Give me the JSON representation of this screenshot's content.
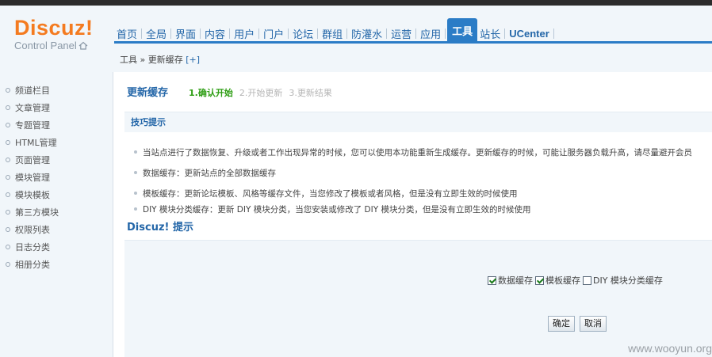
{
  "header": {
    "logo": "Discuz!",
    "logo_sub": "Control Panel",
    "nav": [
      {
        "label": "首页",
        "active": false
      },
      {
        "label": "全局",
        "active": false
      },
      {
        "label": "界面",
        "active": false
      },
      {
        "label": "内容",
        "active": false
      },
      {
        "label": "用户",
        "active": false
      },
      {
        "label": "门户",
        "active": false
      },
      {
        "label": "论坛",
        "active": false
      },
      {
        "label": "群组",
        "active": false
      },
      {
        "label": "防灌水",
        "active": false
      },
      {
        "label": "运营",
        "active": false
      },
      {
        "label": "应用",
        "active": false
      },
      {
        "label": "工具",
        "active": true
      },
      {
        "label": "站长",
        "active": false
      },
      {
        "label": "UCenter",
        "active": false
      }
    ],
    "breadcrumb": {
      "path": "工具 » 更新缓存",
      "add": "[+]"
    }
  },
  "sidebar": {
    "items": [
      {
        "label": "频道栏目"
      },
      {
        "label": "文章管理"
      },
      {
        "label": "专题管理"
      },
      {
        "label": "HTML管理"
      },
      {
        "label": "页面管理"
      },
      {
        "label": "模块管理"
      },
      {
        "label": "模块模板"
      },
      {
        "label": "第三方模块"
      },
      {
        "label": "权限列表"
      },
      {
        "label": "日志分类"
      },
      {
        "label": "相册分类"
      }
    ]
  },
  "main": {
    "title": "更新缓存",
    "steps": [
      {
        "label": "1.确认开始",
        "state": "current"
      },
      {
        "label": "2.开始更新",
        "state": "pending"
      },
      {
        "label": "3.更新结果",
        "state": "pending"
      }
    ],
    "tips_title": "技巧提示",
    "tips": [
      "当站点进行了数据恢复、升级或者工作出现异常的时候，您可以使用本功能重新生成缓存。更新缓存的时候，可能让服务器负载升高，请尽量避开会员",
      "数据缓存：更新站点的全部数据缓存",
      "模板缓存：更新论坛模板、风格等缓存文件，当您修改了模板或者风格，但是没有立即生效的时候使用",
      "DIY 模块分类缓存：更新 DIY 模块分类，当您安装或修改了 DIY 模块分类，但是没有立即生效的时候使用"
    ],
    "subtitle": "Discuz! 提示",
    "options": [
      {
        "label": "数据缓存",
        "checked": true
      },
      {
        "label": "模板缓存",
        "checked": true
      },
      {
        "label": "DIY 模块分类缓存",
        "checked": false
      }
    ],
    "confirm_label": "确定",
    "cancel_label": "取消"
  },
  "watermark": "www.wooyun.org",
  "colors": {
    "brand": "#f47b20",
    "nav_active": "#2b7cc6",
    "link": "#2366a8",
    "step_current": "#2f9e15"
  }
}
